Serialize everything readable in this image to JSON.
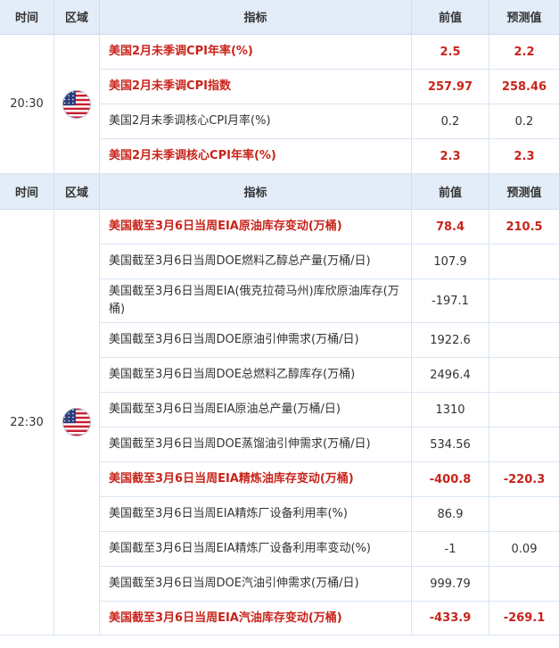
{
  "headers": {
    "time": "时间",
    "region": "区域",
    "indicator": "指标",
    "previous": "前值",
    "forecast": "预测值"
  },
  "sections": [
    {
      "time": "20:30",
      "region_icon": "us-flag-icon",
      "rows": [
        {
          "indicator": "美国2月未季调CPI年率(%)",
          "previous": "2.5",
          "forecast": "2.2",
          "highlight": true
        },
        {
          "indicator": "美国2月未季调CPI指数",
          "previous": "257.97",
          "forecast": "258.46",
          "highlight": true
        },
        {
          "indicator": "美国2月未季调核心CPI月率(%)",
          "previous": "0.2",
          "forecast": "0.2",
          "highlight": false
        },
        {
          "indicator": "美国2月未季调核心CPI年率(%)",
          "previous": "2.3",
          "forecast": "2.3",
          "highlight": true
        }
      ]
    },
    {
      "time": "22:30",
      "region_icon": "us-flag-icon",
      "rows": [
        {
          "indicator": "美国截至3月6日当周EIA原油库存变动(万桶)",
          "previous": "78.4",
          "forecast": "210.5",
          "highlight": true
        },
        {
          "indicator": "美国截至3月6日当周DOE燃料乙醇总产量(万桶/日)",
          "previous": "107.9",
          "forecast": "",
          "highlight": false
        },
        {
          "indicator": "美国截至3月6日当周EIA(俄克拉荷马州)库欣原油库存(万桶)",
          "previous": "-197.1",
          "forecast": "",
          "highlight": false
        },
        {
          "indicator": "美国截至3月6日当周DOE原油引伸需求(万桶/日)",
          "previous": "1922.6",
          "forecast": "",
          "highlight": false
        },
        {
          "indicator": "美国截至3月6日当周DOE总燃料乙醇库存(万桶)",
          "previous": "2496.4",
          "forecast": "",
          "highlight": false
        },
        {
          "indicator": "美国截至3月6日当周EIA原油总产量(万桶/日)",
          "previous": "1310",
          "forecast": "",
          "highlight": false
        },
        {
          "indicator": "美国截至3月6日当周DOE蒸馏油引伸需求(万桶/日)",
          "previous": "534.56",
          "forecast": "",
          "highlight": false
        },
        {
          "indicator": "美国截至3月6日当周EIA精炼油库存变动(万桶)",
          "previous": "-400.8",
          "forecast": "-220.3",
          "highlight": true
        },
        {
          "indicator": "美国截至3月6日当周EIA精炼厂设备利用率(%)",
          "previous": "86.9",
          "forecast": "",
          "highlight": false
        },
        {
          "indicator": "美国截至3月6日当周EIA精炼厂设备利用率变动(%)",
          "previous": "-1",
          "forecast": "0.09",
          "highlight": false
        },
        {
          "indicator": "美国截至3月6日当周DOE汽油引伸需求(万桶/日)",
          "previous": "999.79",
          "forecast": "",
          "highlight": false
        },
        {
          "indicator": "美国截至3月6日当周EIA汽油库存变动(万桶)",
          "previous": "-433.9",
          "forecast": "-269.1",
          "highlight": true
        }
      ]
    }
  ],
  "colors": {
    "highlight": "#c8241b",
    "header_bg": "#e3edf8",
    "border": "#d9e5f2"
  }
}
